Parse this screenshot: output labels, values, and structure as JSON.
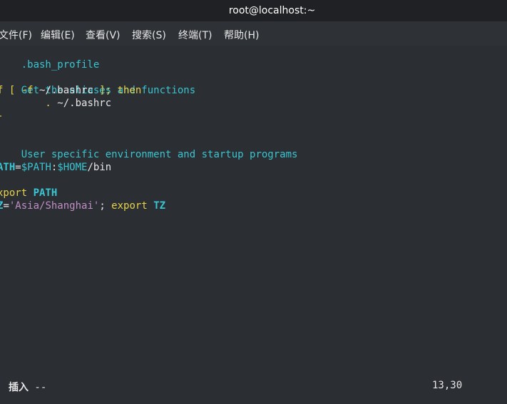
{
  "window": {
    "title": "root@localhost:~"
  },
  "menu": [
    {
      "label": "文件(F)"
    },
    {
      "label": "编辑(E)"
    },
    {
      "label": "查看(V)"
    },
    {
      "label": "搜索(S)"
    },
    {
      "label": "终端(T)"
    },
    {
      "label": "帮助(H)"
    }
  ],
  "editor": {
    "l1": ".bash_profile",
    "l3": "Get the aliases and functions",
    "l4a": "f",
    "l4b": " [ -f ",
    "l4c": "~/.bashrc",
    "l4d": " ]; then",
    "l5a": "        . ",
    "l5b": "~/.bashrc",
    "l6": "-",
    "l8": "User specific environment and startup programs",
    "l10a": "ATH",
    "l10b": "=",
    "l10c": "$PATH",
    "l10d": ":",
    "l10e": "$HOME",
    "l10f": "/bin",
    "l12a": "xport ",
    "l12b": "PATH",
    "l13a": "Z",
    "l13b": "=",
    "l13c": "'Asia/Shanghai'",
    "l13d": "; ",
    "l13e": "export ",
    "l13f": "TZ"
  },
  "status": {
    "mode": "插入",
    "dashes": " --",
    "position": "13,30"
  }
}
